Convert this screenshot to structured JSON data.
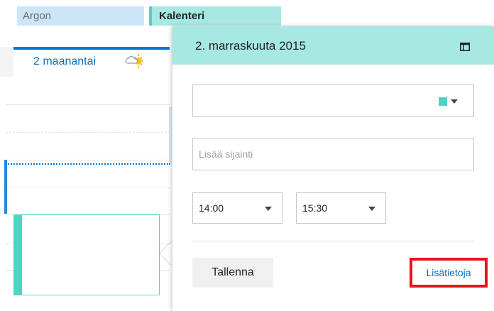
{
  "calendars": {
    "tag_1": "Argon",
    "tag_2": "Kalenteri"
  },
  "day": {
    "header": "2 maanantai",
    "weather_icon": "partly-sunny-icon"
  },
  "peek": {
    "title": "2. marraskuuta 2015",
    "expand_icon": "expand-window-icon",
    "title_value": "",
    "calendar_color": "#4cd4c4",
    "location_placeholder": "Lisää sijainti",
    "location_value": "",
    "start_time": "14:00",
    "end_time": "15:30",
    "save_label": "Tallenna",
    "more_details_label": "Lisätietoja"
  },
  "colors": {
    "accent_blue": "#0078d7",
    "calendar_teal": "#4cd4c4",
    "header_teal": "#a6e8e2",
    "highlight_red": "#e8141c"
  }
}
